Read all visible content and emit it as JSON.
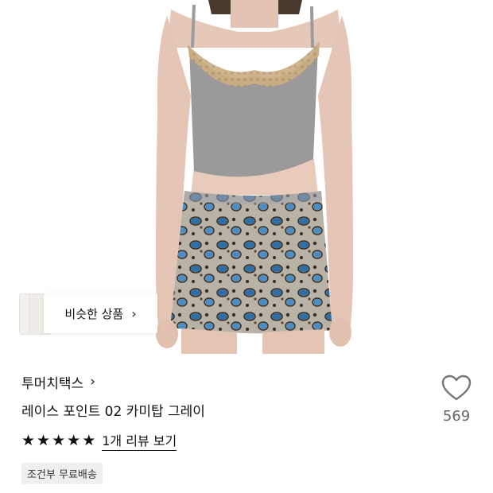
{
  "product": {
    "brand": "투머치택스",
    "name": "레이스 포인트 02 카미탑 그레이",
    "rating_stars": 5,
    "review_link": "1개 리뷰 보기",
    "shipping_badge": "조건부 무료배송",
    "like_count": "569"
  },
  "similar": {
    "label": "비슷한 상품"
  },
  "icons": {
    "brand_chevron": "chevron-right-icon",
    "similar_chevron": "chevron-right-icon",
    "like": "heart-outline-icon",
    "star": "star-filled-icon"
  },
  "colors": {
    "text": "#111111",
    "count": "#666666",
    "badge_bg": "#efefef"
  }
}
